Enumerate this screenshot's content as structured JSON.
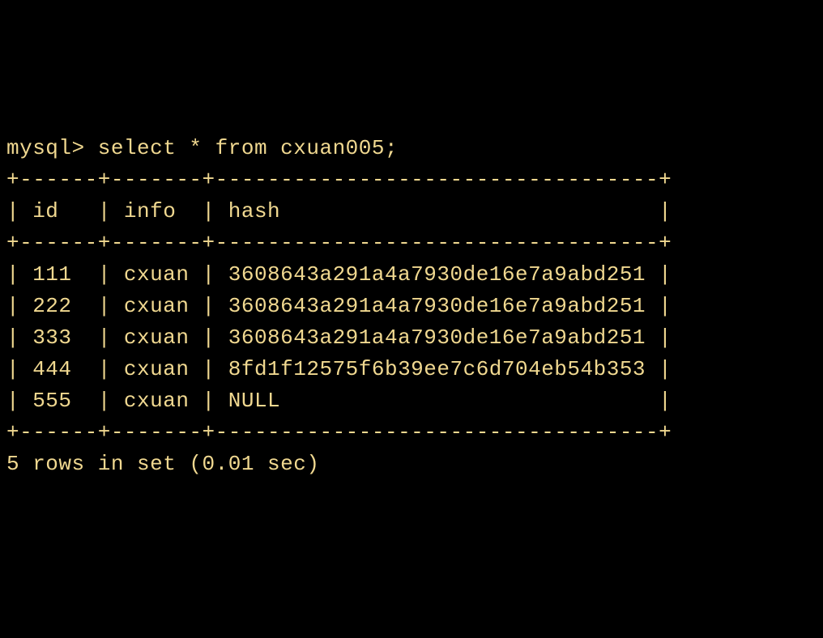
{
  "prompt": "mysql> ",
  "query": "select * from cxuan005;",
  "border_top": "+------+-------+----------------------------------+",
  "border_mid": "+------+-------+----------------------------------+",
  "border_bottom": "+------+-------+----------------------------------+",
  "header_row": "| id   | info  | hash                             |",
  "columns": [
    "id",
    "info",
    "hash"
  ],
  "rows": [
    {
      "id": "111",
      "info": "cxuan",
      "hash": "3608643a291a4a7930de16e7a9abd251"
    },
    {
      "id": "222",
      "info": "cxuan",
      "hash": "3608643a291a4a7930de16e7a9abd251"
    },
    {
      "id": "333",
      "info": "cxuan",
      "hash": "3608643a291a4a7930de16e7a9abd251"
    },
    {
      "id": "444",
      "info": "cxuan",
      "hash": "8fd1f12575f6b39ee7c6d704eb54b353"
    },
    {
      "id": "555",
      "info": "cxuan",
      "hash": "NULL"
    }
  ],
  "row_lines": [
    "| 111  | cxuan | 3608643a291a4a7930de16e7a9abd251 |",
    "| 222  | cxuan | 3608643a291a4a7930de16e7a9abd251 |",
    "| 333  | cxuan | 3608643a291a4a7930de16e7a9abd251 |",
    "| 444  | cxuan | 8fd1f12575f6b39ee7c6d704eb54b353 |",
    "| 555  | cxuan | NULL                             |"
  ],
  "footer": "5 rows in set (0.01 sec)"
}
